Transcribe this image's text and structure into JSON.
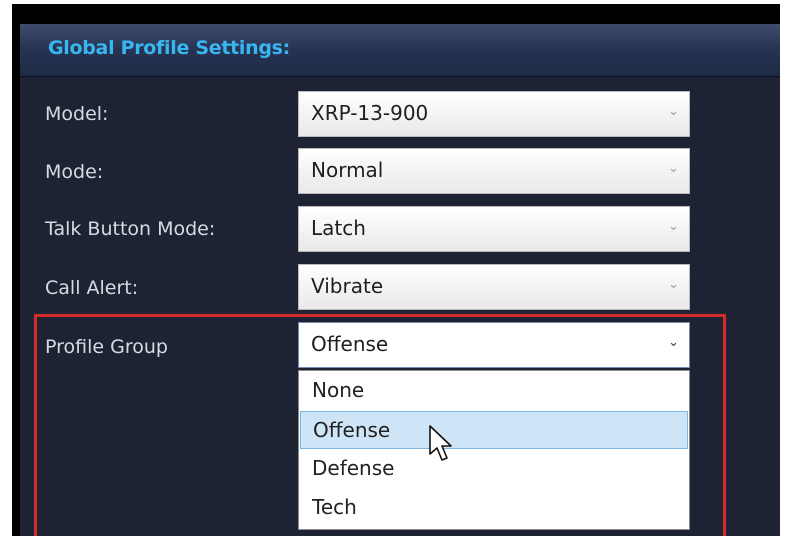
{
  "header": {
    "title": "Global Profile Settings:"
  },
  "fields": [
    {
      "label": "Model:",
      "value": "XRP-13-900"
    },
    {
      "label": "Mode:",
      "value": "Normal"
    },
    {
      "label": "Talk Button Mode:",
      "value": "Latch"
    },
    {
      "label": "Call Alert:",
      "value": "Vibrate"
    }
  ],
  "profile_group": {
    "label": "Profile Group",
    "value": "Offense",
    "options": [
      "None",
      "Offense",
      "Defense",
      "Tech"
    ],
    "highlighted_option": "Offense"
  },
  "icons": {
    "chevron": "chevron-down-icon",
    "cursor": "mouse-pointer-icon"
  },
  "colors": {
    "highlight_border": "#d62b2b",
    "title": "#38b6f0",
    "selected_option": "#cde5f7"
  }
}
